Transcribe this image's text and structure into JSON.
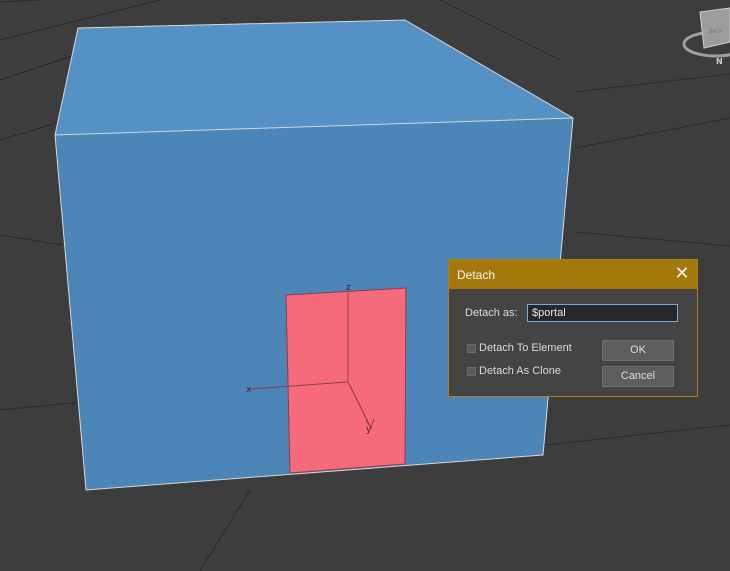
{
  "viewport": {
    "gizmo_axes": {
      "x": "x",
      "y": "y",
      "z": "z"
    },
    "viewcube": {
      "face_label": "BACK",
      "compass_label": "N"
    },
    "colors": {
      "background": "#3d3d3d",
      "box": "#4f89bb",
      "selection": "#f56b7b"
    }
  },
  "dialog": {
    "title": "Detach",
    "close_glyph": "✕",
    "detach_as_label": "Detach as:",
    "detach_as_value": "$portal",
    "checkboxes": [
      {
        "label": "Detach To Element",
        "checked": false
      },
      {
        "label": "Detach As Clone",
        "checked": false
      }
    ],
    "ok_label": "OK",
    "cancel_label": "Cancel",
    "accent_color": "#a5780c"
  }
}
